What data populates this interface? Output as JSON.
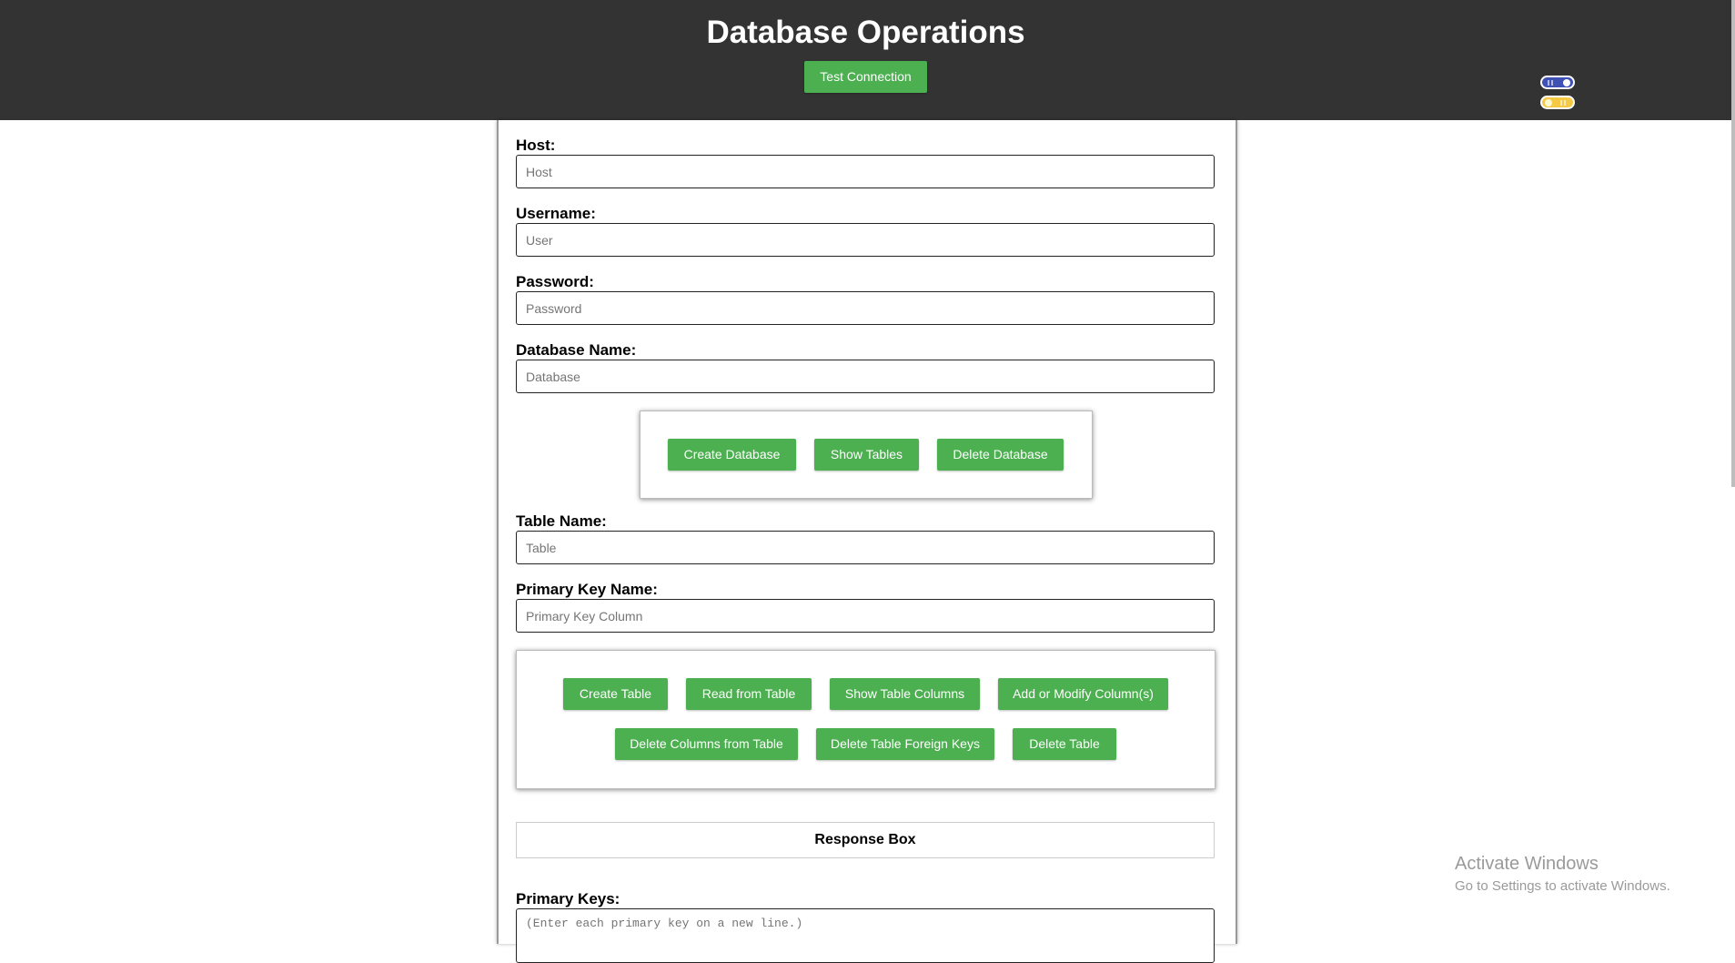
{
  "header": {
    "title": "Database Operations",
    "test_connection_label": "Test Connection",
    "theme_toggle_dark": "dark-mode-toggle-icon",
    "theme_toggle_light": "light-mode-toggle-icon"
  },
  "form": {
    "host": {
      "label": "Host:",
      "placeholder": "Host",
      "value": ""
    },
    "username": {
      "label": "Username:",
      "placeholder": "User",
      "value": ""
    },
    "password": {
      "label": "Password:",
      "placeholder": "Password",
      "value": ""
    },
    "database": {
      "label": "Database Name:",
      "placeholder": "Database",
      "value": ""
    },
    "table": {
      "label": "Table Name:",
      "placeholder": "Table",
      "value": ""
    },
    "primary_key": {
      "label": "Primary Key Name:",
      "placeholder": "Primary Key Column",
      "value": ""
    },
    "primary_keys": {
      "label": "Primary Keys:",
      "placeholder": "(Enter each primary key on a new line.)",
      "value": ""
    }
  },
  "database_actions": {
    "create": "Create Database",
    "show_tables": "Show Tables",
    "delete": "Delete Database"
  },
  "table_actions": {
    "create": "Create Table",
    "read": "Read from Table",
    "show_columns": "Show Table Columns",
    "add_modify": "Add or Modify Column(s)",
    "delete_columns": "Delete Columns from Table",
    "delete_foreign_keys": "Delete Table Foreign Keys",
    "delete_table": "Delete Table"
  },
  "response_box": {
    "title": "Response Box"
  },
  "windows_watermark": {
    "title": "Activate Windows",
    "subtitle": "Go to Settings to activate Windows."
  },
  "colors": {
    "header_bg": "#333333",
    "button_bg": "#4caf50",
    "toggle_dark": "#3f51b5",
    "toggle_light": "#f6c945"
  }
}
